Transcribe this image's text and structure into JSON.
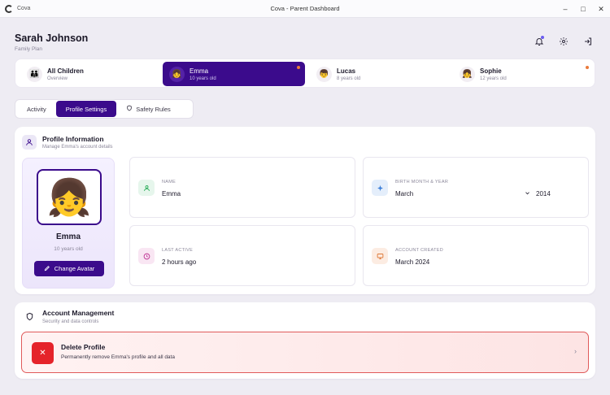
{
  "window": {
    "app_name": "Cova",
    "title": "Cova - Parent Dashboard",
    "controls": {
      "minimize": "–",
      "maximize": "□",
      "close": "✕"
    }
  },
  "header": {
    "user_name": "Sarah Johnson",
    "plan": "Family Plan",
    "icons": [
      "bell-icon",
      "gear-icon",
      "logout-icon"
    ]
  },
  "children": [
    {
      "name": "All Children",
      "subtitle": "Overview",
      "avatar": "👪",
      "active": false
    },
    {
      "name": "Emma",
      "subtitle": "10 years old",
      "avatar": "👧",
      "active": true
    },
    {
      "name": "Lucas",
      "subtitle": "8 years old",
      "avatar": "👦",
      "active": false
    },
    {
      "name": "Sophie",
      "subtitle": "12 years old",
      "avatar": "👧",
      "active": false
    }
  ],
  "tabs": [
    {
      "label": "Activity",
      "active": false
    },
    {
      "label": "Profile Settings",
      "active": true
    },
    {
      "label": "Safety Rules",
      "active": false,
      "icon": "shield-icon"
    }
  ],
  "profile": {
    "title": "Profile Information",
    "subtitle": "Manage Emma's account details",
    "avatar_emoji": "👧",
    "name": "Emma",
    "age": "10 years old",
    "change_avatar_label": "Change Avatar",
    "fields": {
      "name": {
        "label": "NAME",
        "value": "Emma"
      },
      "birth": {
        "label": "BIRTH MONTH & YEAR",
        "month": "March",
        "year": "2014"
      },
      "last_active": {
        "label": "LAST ACTIVE",
        "value": "2 hours ago"
      },
      "created": {
        "label": "ACCOUNT CREATED",
        "value": "March 2024"
      }
    }
  },
  "account": {
    "title": "Account Management",
    "subtitle": "Security and data controls",
    "delete_title": "Delete Profile",
    "delete_desc": "Permanently remove Emma's profile and all data"
  },
  "colors": {
    "accent": "#3b0b8c",
    "danger": "#e5232a",
    "status_dot": "#ea7a3a"
  }
}
